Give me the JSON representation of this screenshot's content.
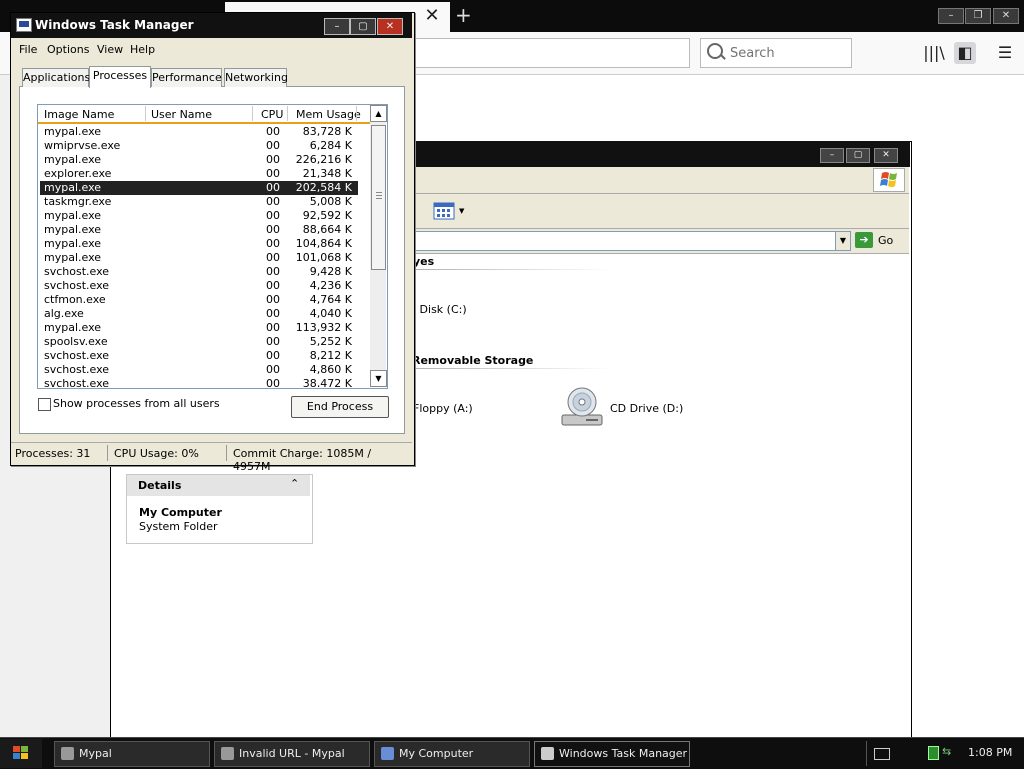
{
  "browser": {
    "search_placeholder": "Search"
  },
  "my_computer": {
    "section_hard_disks": "yes",
    "drive_local": "l Disk (C:)",
    "section_removable": "Removable Storage",
    "drive_floppy": "Floppy (A:)",
    "drive_cd": "CD Drive (D:)",
    "go_label": "Go",
    "details": {
      "title": "Details",
      "name": "My Computer",
      "type": "System Folder"
    }
  },
  "task_manager": {
    "title": "Windows Task Manager",
    "menu": [
      "File",
      "Options",
      "View",
      "Help"
    ],
    "tabs": [
      "Applications",
      "Processes",
      "Performance",
      "Networking"
    ],
    "active_tab": "Processes",
    "columns": [
      "Image Name",
      "User Name",
      "CPU",
      "Mem Usage"
    ],
    "processes": [
      {
        "name": "mypal.exe",
        "user": "",
        "cpu": "00",
        "mem": "83,728 K"
      },
      {
        "name": "wmiprvse.exe",
        "user": "",
        "cpu": "00",
        "mem": "6,284 K"
      },
      {
        "name": "mypal.exe",
        "user": "",
        "cpu": "00",
        "mem": "226,216 K"
      },
      {
        "name": "explorer.exe",
        "user": "",
        "cpu": "00",
        "mem": "21,348 K"
      },
      {
        "name": "mypal.exe",
        "user": "",
        "cpu": "00",
        "mem": "202,584 K",
        "selected": true
      },
      {
        "name": "taskmgr.exe",
        "user": "",
        "cpu": "00",
        "mem": "5,008 K"
      },
      {
        "name": "mypal.exe",
        "user": "",
        "cpu": "00",
        "mem": "92,592 K"
      },
      {
        "name": "mypal.exe",
        "user": "",
        "cpu": "00",
        "mem": "88,664 K"
      },
      {
        "name": "mypal.exe",
        "user": "",
        "cpu": "00",
        "mem": "104,864 K"
      },
      {
        "name": "mypal.exe",
        "user": "",
        "cpu": "00",
        "mem": "101,068 K"
      },
      {
        "name": "svchost.exe",
        "user": "",
        "cpu": "00",
        "mem": "9,428 K"
      },
      {
        "name": "svchost.exe",
        "user": "",
        "cpu": "00",
        "mem": "4,236 K"
      },
      {
        "name": "ctfmon.exe",
        "user": "",
        "cpu": "00",
        "mem": "4,764 K"
      },
      {
        "name": "alg.exe",
        "user": "",
        "cpu": "00",
        "mem": "4,040 K"
      },
      {
        "name": "mypal.exe",
        "user": "",
        "cpu": "00",
        "mem": "113,932 K"
      },
      {
        "name": "spoolsv.exe",
        "user": "",
        "cpu": "00",
        "mem": "5,252 K"
      },
      {
        "name": "svchost.exe",
        "user": "",
        "cpu": "00",
        "mem": "8,212 K"
      },
      {
        "name": "svchost.exe",
        "user": "",
        "cpu": "00",
        "mem": "4,860 K"
      },
      {
        "name": "svchost.exe",
        "user": "",
        "cpu": "00",
        "mem": "38,472 K"
      }
    ],
    "show_all_label": "Show processes from all users",
    "end_process_label": "End Process",
    "status": {
      "processes": "Processes: 31",
      "cpu": "CPU Usage: 0%",
      "commit": "Commit Charge: 1085M / 4957M"
    }
  },
  "taskbar": {
    "buttons": [
      {
        "label": "Mypal",
        "active": false
      },
      {
        "label": "Invalid URL - Mypal",
        "active": false
      },
      {
        "label": "My Computer",
        "active": false
      },
      {
        "label": "Windows Task Manager",
        "active": true
      }
    ],
    "clock": "1:08 PM"
  },
  "colors": {
    "selection": "#222222",
    "header_accent": "#e8a018",
    "title_bar": "#111111",
    "close_button": "#b73020"
  }
}
